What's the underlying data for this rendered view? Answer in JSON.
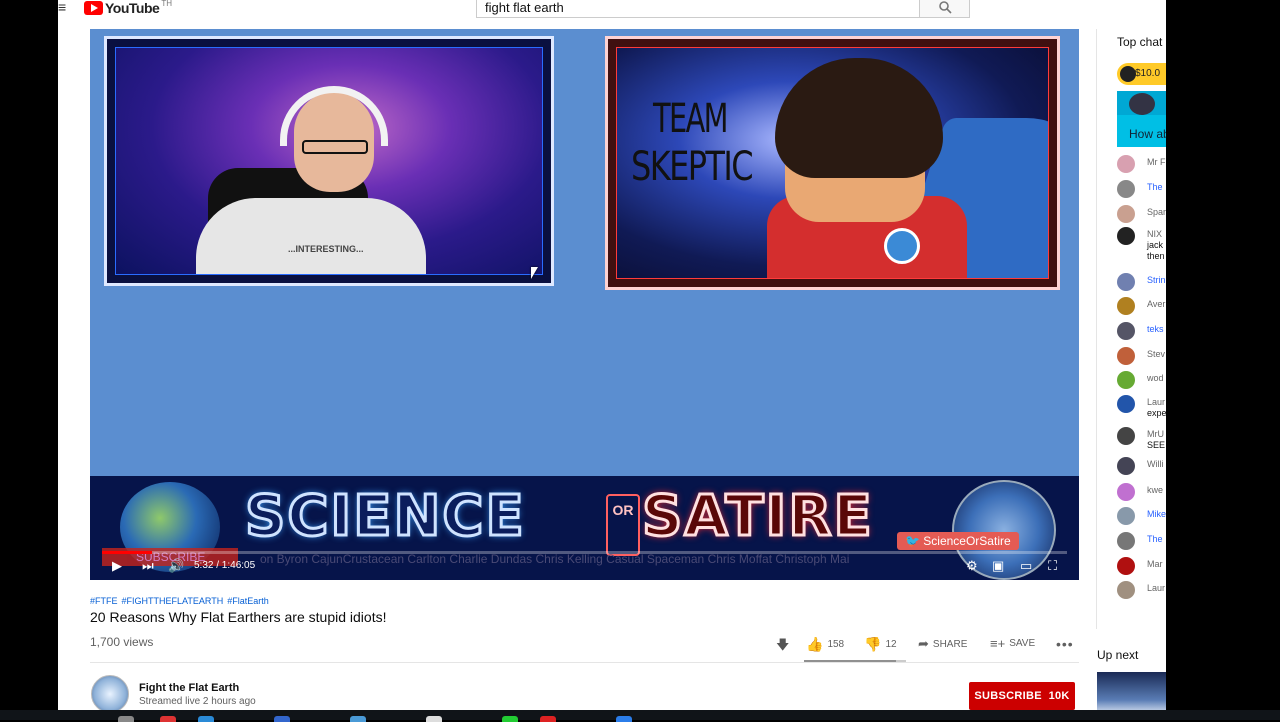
{
  "header": {
    "logo_text": "YouTube",
    "logo_region": "TH",
    "search_value": "fight flat earth"
  },
  "player": {
    "overlay_team_line1": "TEAM",
    "overlay_team_line2": "SKEPTIC",
    "shirt_text": "...INTERESTING...",
    "banner_left": "SCIENCE",
    "banner_mid": "OR",
    "banner_right": "SATIRE",
    "twitter_handle": "ScienceOrSatire",
    "ticker": "on Byron CajunCrustacean Carlton Charlie Dundas Chris Kelling Casual Spaceman Chris Moffat Christoph Mai",
    "subscribe_overlay": "SUBSCRIBE",
    "time_current": "5:32",
    "time_total": "1:46:05",
    "time_display": "5:32 / 1:46:05",
    "progress_fraction": 0.052
  },
  "video": {
    "hashtags": [
      "#FTFE",
      "#FIGHTTHEFLATEARTH",
      "#FlatEarth"
    ],
    "title": "20 Reasons Why Flat Earthers are stupid idiots!",
    "views": "1,700 views",
    "likes": "158",
    "dislikes": "12",
    "share_label": "SHARE",
    "save_label": "SAVE"
  },
  "channel": {
    "name": "Fight the Flat Earth",
    "meta": "Streamed live 2 hours ago",
    "subscribe_label": "SUBSCRIBE",
    "subscriber_count": "10K"
  },
  "chat": {
    "title": "Top chat",
    "superchat_amount": "$10.0",
    "superchat_text": "How ab",
    "messages": [
      {
        "name": "Mr F",
        "text": "",
        "color": "#d8a0b0",
        "blue": false
      },
      {
        "name": "The",
        "text": "",
        "color": "#888",
        "blue": true
      },
      {
        "name": "Spar",
        "text": "",
        "color": "#c9a090",
        "blue": false
      },
      {
        "name": "NIX",
        "text": "jack",
        "extra": "then",
        "color": "#222",
        "blue": false
      },
      {
        "name": "Strin",
        "text": "",
        "color": "#7080b0",
        "blue": true
      },
      {
        "name": "Aver",
        "text": "",
        "color": "#b08020",
        "blue": false
      },
      {
        "name": "teks",
        "text": "",
        "color": "#556",
        "blue": true
      },
      {
        "name": "Stev",
        "text": "",
        "color": "#c0603a",
        "blue": false
      },
      {
        "name": "wod",
        "text": "",
        "color": "#6a3",
        "blue": false
      },
      {
        "name": "Laur",
        "text": "expe",
        "color": "#2255aa",
        "blue": false
      },
      {
        "name": "MrU",
        "text": "SEE",
        "color": "#444",
        "blue": false
      },
      {
        "name": "Willi",
        "text": "",
        "color": "#445",
        "blue": false
      },
      {
        "name": "kwe",
        "text": "",
        "color": "#c070d0",
        "blue": false
      },
      {
        "name": "Mike",
        "text": "",
        "color": "#8899aa",
        "blue": true
      },
      {
        "name": "The",
        "text": "",
        "color": "#777",
        "blue": true
      },
      {
        "name": "Mar",
        "text": "",
        "color": "#b01010",
        "blue": false
      },
      {
        "name": "Laur",
        "text": "",
        "color": "#a09080",
        "blue": false
      }
    ],
    "up_next": "Up next"
  }
}
